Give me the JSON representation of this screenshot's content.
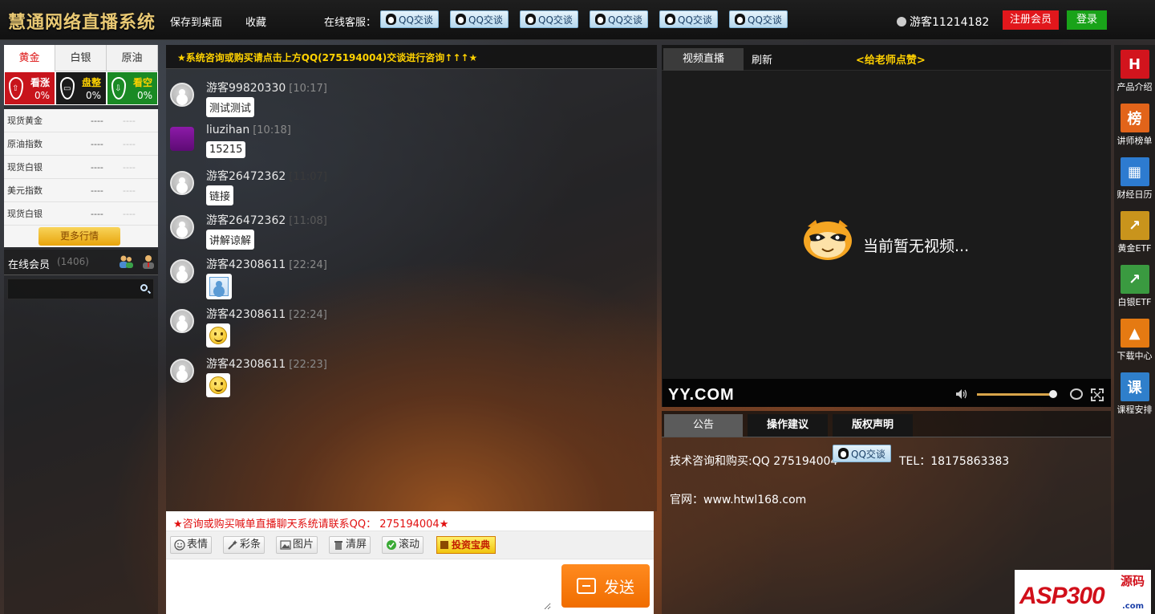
{
  "header": {
    "logo": "慧通网络直播系统",
    "save_desktop": "保存到桌面",
    "favorite": "收藏",
    "online_service_label": "在线客服：",
    "qq_buttons": [
      "QQ交谈",
      "QQ交谈",
      "QQ交谈",
      "QQ交谈",
      "QQ交谈",
      "QQ交谈"
    ],
    "guest": "游客11214182",
    "register": "注册会员",
    "login": "登录"
  },
  "market": {
    "tabs": [
      "黄金",
      "白银",
      "原油"
    ],
    "active_tab": "黄金",
    "sentiment": [
      {
        "label": "看涨",
        "pct": "0%",
        "color": "#c8141c",
        "arrow": "⇧"
      },
      {
        "label": "盘整",
        "pct": "0%",
        "color": "#1a1a1a",
        "arrow": "▭"
      },
      {
        "label": "看空",
        "pct": "0%",
        "color": "#1a8a24",
        "arrow": "⇩"
      }
    ],
    "quotes": [
      {
        "name": "现货黄金",
        "value": "----",
        "change": "----"
      },
      {
        "name": "原油指数",
        "value": "----",
        "change": "----"
      },
      {
        "name": "现货白银",
        "value": "----",
        "change": "----"
      },
      {
        "name": "美元指数",
        "value": "----",
        "change": "----"
      },
      {
        "name": "现货白银",
        "value": "----",
        "change": "----"
      }
    ],
    "more": "更多行情"
  },
  "members": {
    "title": "在线会员",
    "count": "(1406)",
    "search_placeholder": ""
  },
  "chat": {
    "notice": "★系统咨询或购买请点击上方QQ(275194004)交谈进行咨询↑↑↑★",
    "messages": [
      {
        "user": "游客99820330",
        "time": "[10:17]",
        "text": "测试测试",
        "type": "text",
        "vip": false
      },
      {
        "user": "liuzihan",
        "time": "[10:18]",
        "text": "15215",
        "type": "text",
        "vip": true
      },
      {
        "user": "游客26472362",
        "time": "[11:07]",
        "text": "链接",
        "type": "text",
        "vip": false
      },
      {
        "user": "游客26472362",
        "time": "[11:08]",
        "text": "讲解谅解",
        "type": "text",
        "vip": false
      },
      {
        "user": "游客42308611",
        "time": "[22:24]",
        "text": "",
        "type": "image",
        "vip": false
      },
      {
        "user": "游客42308611",
        "time": "[22:24]",
        "text": "",
        "type": "smiley",
        "vip": false
      },
      {
        "user": "游客42308611",
        "time": "[22:23]",
        "text": "",
        "type": "smiley",
        "vip": false
      }
    ],
    "composer_notice": "★咨询或购买喊单直播聊天系统请联系QQ： 275194004★",
    "toolbar": {
      "emoji": "表情",
      "caitiao": "彩条",
      "image": "图片",
      "clear": "清屏",
      "scroll": "滚动",
      "bible": "投资宝典"
    },
    "send": "发送"
  },
  "video": {
    "tab_live": "视频直播",
    "tab_refresh": "刷新",
    "like": "<给老师点赞>",
    "no_video": "当前暂无视频...",
    "brand": "YY.COM",
    "volume": 0.95
  },
  "announce": {
    "tabs": [
      "公告",
      "操作建议",
      "版权声明"
    ],
    "line1": "技术咨询和购买:QQ 275194004",
    "qq_button": "QQ交谈",
    "tel": "TEL：18175863383",
    "line2": "官网：www.htwl168.com"
  },
  "sidebar": [
    {
      "label": "产品介绍",
      "glyph": "H",
      "color": "#d2141d"
    },
    {
      "label": "讲师榜单",
      "glyph": "榜",
      "color": "#e2641a"
    },
    {
      "label": "财经日历",
      "glyph": "▦",
      "color": "#2d7bd0"
    },
    {
      "label": "黄金ETF",
      "glyph": "↗",
      "color": "#c9941c"
    },
    {
      "label": "白银ETF",
      "glyph": "↗",
      "color": "#3a9a40"
    },
    {
      "label": "下载中心",
      "glyph": "▲",
      "color": "#e57a12"
    },
    {
      "label": "课程安排",
      "glyph": "课",
      "color": "#2f7fcb"
    }
  ],
  "watermark": {
    "text": "ASP300",
    "cn": "源码",
    "com": ".com"
  }
}
